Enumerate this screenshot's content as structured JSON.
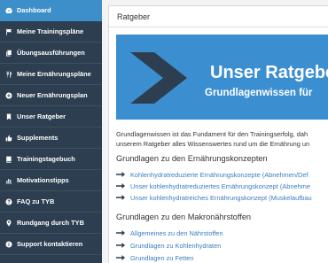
{
  "sidebar": {
    "items": [
      {
        "label": "Dashboard",
        "icon": "dashboard-icon"
      },
      {
        "label": "Meine Trainingspläne",
        "icon": "flag-icon"
      },
      {
        "label": "Übungsausführungen",
        "icon": "copy-icon"
      },
      {
        "label": "Meine Ernährungspläne",
        "icon": "cutlery-icon"
      },
      {
        "label": "Neuer Ernährungsplan",
        "icon": "plus-circle-icon"
      },
      {
        "label": "Unser Ratgeber",
        "icon": "bookmark-icon"
      },
      {
        "label": "Supplements",
        "icon": "thumbs-up-icon"
      },
      {
        "label": "Trainingstagebuch",
        "icon": "book-icon"
      },
      {
        "label": "Motivationstipps",
        "icon": "bar-chart-icon"
      },
      {
        "label": "FAQ zu TYB",
        "icon": "question-circle-icon"
      },
      {
        "label": "Rundgang durch TYB",
        "icon": "map-marker-icon"
      },
      {
        "label": "Support kontaktieren",
        "icon": "info-circle-icon"
      }
    ],
    "active_index": 0
  },
  "main": {
    "heading": "Ratgeber",
    "banner": {
      "title": "Unser Ratgeber",
      "subtitle": "Grundlagenwissen für"
    },
    "intro_line1": "Grundlagenwissen ist das Fundament für den Trainingserfolg, dah",
    "intro_line2": "unserem Ratgeber alles Wissenswertes rund um die Ernährung un",
    "section1": {
      "title": "Grundlagen zu den Ernährungskonzepten",
      "links": [
        "Kohlenhydratreduzierte Ernährungskonzepte (Abnehmen/Def",
        "Unser kohlenhydratreduziertes Ernährungskonzept (Abnehme",
        "Unser kohlenhydratreiches Ernährungskonzept (Muskelaufbau"
      ]
    },
    "section2": {
      "title": "Grundlagen zu den Makronährstoffen",
      "links": [
        "Allgemeines zu den Nährstoffen",
        "Grundlagen zu Kohlenhydraten",
        "Grundlagen zu Fetten"
      ]
    }
  },
  "colors": {
    "sidebar_bg": "#2c3e4f",
    "active": "#3d8fc9",
    "banner_bg": "#3b8fd1",
    "chevron": "#2c3e50",
    "link": "#3a7dc2"
  }
}
